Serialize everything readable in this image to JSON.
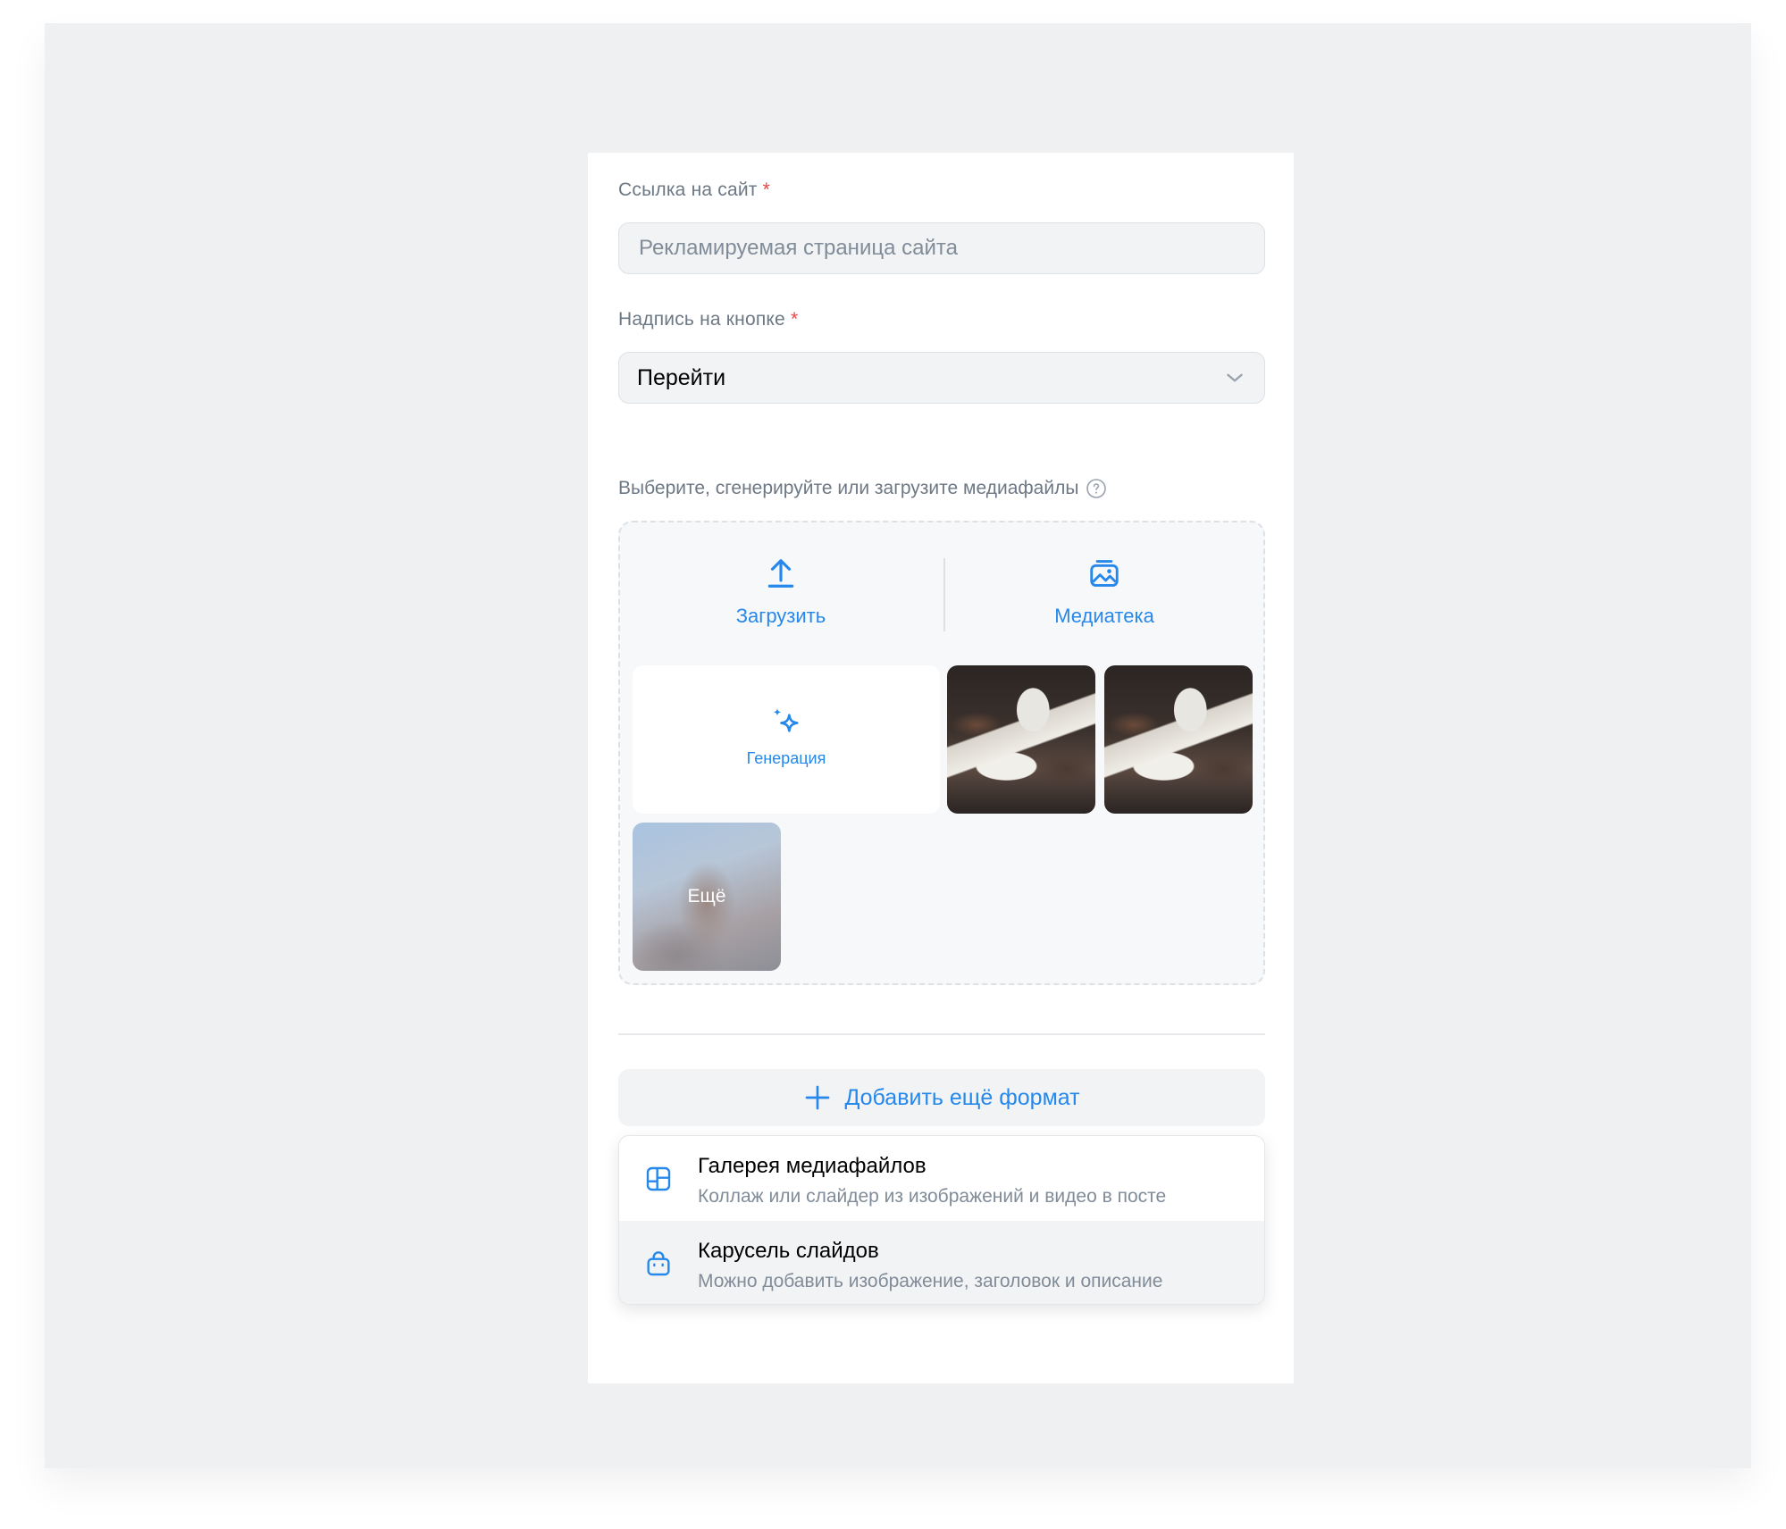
{
  "form": {
    "site_link": {
      "label": "Ссылка на сайт",
      "required_mark": "*",
      "placeholder": "Рекламируемая страница сайта",
      "value": ""
    },
    "button_caption": {
      "label": "Надпись на кнопке",
      "required_mark": "*",
      "selected": "Перейти"
    },
    "media": {
      "label": "Выберите, сгенерируйте или загрузите медиафайлы",
      "upload_label": "Загрузить",
      "library_label": "Медиатека",
      "generate_label": "Генерация",
      "more_label": "Ещё"
    },
    "add_format": {
      "label": "Добавить ещё формат"
    },
    "format_menu": [
      {
        "title": "Галерея медиафайлов",
        "subtitle": "Коллаж или слайдер из изображений и видео в посте",
        "icon": "gallery-icon"
      },
      {
        "title": "Карусель слайдов",
        "subtitle": "Можно добавить изображение, заголовок и описание",
        "icon": "bag-icon"
      }
    ]
  },
  "colors": {
    "accent": "#2688eb",
    "required": "#e64646",
    "muted_text": "#6d7885",
    "background": "#eff0f2"
  }
}
